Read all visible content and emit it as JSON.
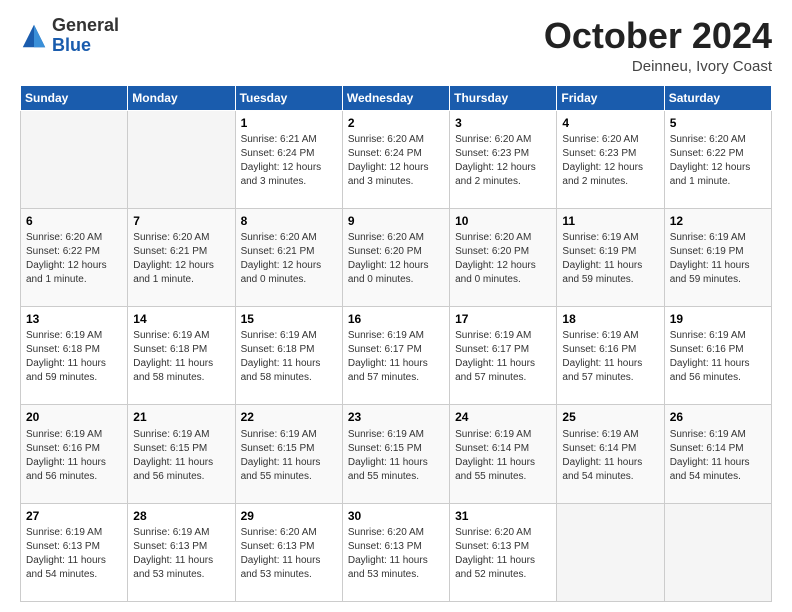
{
  "logo": {
    "general": "General",
    "blue": "Blue"
  },
  "header": {
    "month": "October 2024",
    "location": "Deinneu, Ivory Coast"
  },
  "weekdays": [
    "Sunday",
    "Monday",
    "Tuesday",
    "Wednesday",
    "Thursday",
    "Friday",
    "Saturday"
  ],
  "weeks": [
    [
      {
        "day": "",
        "info": ""
      },
      {
        "day": "",
        "info": ""
      },
      {
        "day": "1",
        "info": "Sunrise: 6:21 AM\nSunset: 6:24 PM\nDaylight: 12 hours and 3 minutes."
      },
      {
        "day": "2",
        "info": "Sunrise: 6:20 AM\nSunset: 6:24 PM\nDaylight: 12 hours and 3 minutes."
      },
      {
        "day": "3",
        "info": "Sunrise: 6:20 AM\nSunset: 6:23 PM\nDaylight: 12 hours and 2 minutes."
      },
      {
        "day": "4",
        "info": "Sunrise: 6:20 AM\nSunset: 6:23 PM\nDaylight: 12 hours and 2 minutes."
      },
      {
        "day": "5",
        "info": "Sunrise: 6:20 AM\nSunset: 6:22 PM\nDaylight: 12 hours and 1 minute."
      }
    ],
    [
      {
        "day": "6",
        "info": "Sunrise: 6:20 AM\nSunset: 6:22 PM\nDaylight: 12 hours and 1 minute."
      },
      {
        "day": "7",
        "info": "Sunrise: 6:20 AM\nSunset: 6:21 PM\nDaylight: 12 hours and 1 minute."
      },
      {
        "day": "8",
        "info": "Sunrise: 6:20 AM\nSunset: 6:21 PM\nDaylight: 12 hours and 0 minutes."
      },
      {
        "day": "9",
        "info": "Sunrise: 6:20 AM\nSunset: 6:20 PM\nDaylight: 12 hours and 0 minutes."
      },
      {
        "day": "10",
        "info": "Sunrise: 6:20 AM\nSunset: 6:20 PM\nDaylight: 12 hours and 0 minutes."
      },
      {
        "day": "11",
        "info": "Sunrise: 6:19 AM\nSunset: 6:19 PM\nDaylight: 11 hours and 59 minutes."
      },
      {
        "day": "12",
        "info": "Sunrise: 6:19 AM\nSunset: 6:19 PM\nDaylight: 11 hours and 59 minutes."
      }
    ],
    [
      {
        "day": "13",
        "info": "Sunrise: 6:19 AM\nSunset: 6:18 PM\nDaylight: 11 hours and 59 minutes."
      },
      {
        "day": "14",
        "info": "Sunrise: 6:19 AM\nSunset: 6:18 PM\nDaylight: 11 hours and 58 minutes."
      },
      {
        "day": "15",
        "info": "Sunrise: 6:19 AM\nSunset: 6:18 PM\nDaylight: 11 hours and 58 minutes."
      },
      {
        "day": "16",
        "info": "Sunrise: 6:19 AM\nSunset: 6:17 PM\nDaylight: 11 hours and 57 minutes."
      },
      {
        "day": "17",
        "info": "Sunrise: 6:19 AM\nSunset: 6:17 PM\nDaylight: 11 hours and 57 minutes."
      },
      {
        "day": "18",
        "info": "Sunrise: 6:19 AM\nSunset: 6:16 PM\nDaylight: 11 hours and 57 minutes."
      },
      {
        "day": "19",
        "info": "Sunrise: 6:19 AM\nSunset: 6:16 PM\nDaylight: 11 hours and 56 minutes."
      }
    ],
    [
      {
        "day": "20",
        "info": "Sunrise: 6:19 AM\nSunset: 6:16 PM\nDaylight: 11 hours and 56 minutes."
      },
      {
        "day": "21",
        "info": "Sunrise: 6:19 AM\nSunset: 6:15 PM\nDaylight: 11 hours and 56 minutes."
      },
      {
        "day": "22",
        "info": "Sunrise: 6:19 AM\nSunset: 6:15 PM\nDaylight: 11 hours and 55 minutes."
      },
      {
        "day": "23",
        "info": "Sunrise: 6:19 AM\nSunset: 6:15 PM\nDaylight: 11 hours and 55 minutes."
      },
      {
        "day": "24",
        "info": "Sunrise: 6:19 AM\nSunset: 6:14 PM\nDaylight: 11 hours and 55 minutes."
      },
      {
        "day": "25",
        "info": "Sunrise: 6:19 AM\nSunset: 6:14 PM\nDaylight: 11 hours and 54 minutes."
      },
      {
        "day": "26",
        "info": "Sunrise: 6:19 AM\nSunset: 6:14 PM\nDaylight: 11 hours and 54 minutes."
      }
    ],
    [
      {
        "day": "27",
        "info": "Sunrise: 6:19 AM\nSunset: 6:13 PM\nDaylight: 11 hours and 54 minutes."
      },
      {
        "day": "28",
        "info": "Sunrise: 6:19 AM\nSunset: 6:13 PM\nDaylight: 11 hours and 53 minutes."
      },
      {
        "day": "29",
        "info": "Sunrise: 6:20 AM\nSunset: 6:13 PM\nDaylight: 11 hours and 53 minutes."
      },
      {
        "day": "30",
        "info": "Sunrise: 6:20 AM\nSunset: 6:13 PM\nDaylight: 11 hours and 53 minutes."
      },
      {
        "day": "31",
        "info": "Sunrise: 6:20 AM\nSunset: 6:13 PM\nDaylight: 11 hours and 52 minutes."
      },
      {
        "day": "",
        "info": ""
      },
      {
        "day": "",
        "info": ""
      }
    ]
  ]
}
